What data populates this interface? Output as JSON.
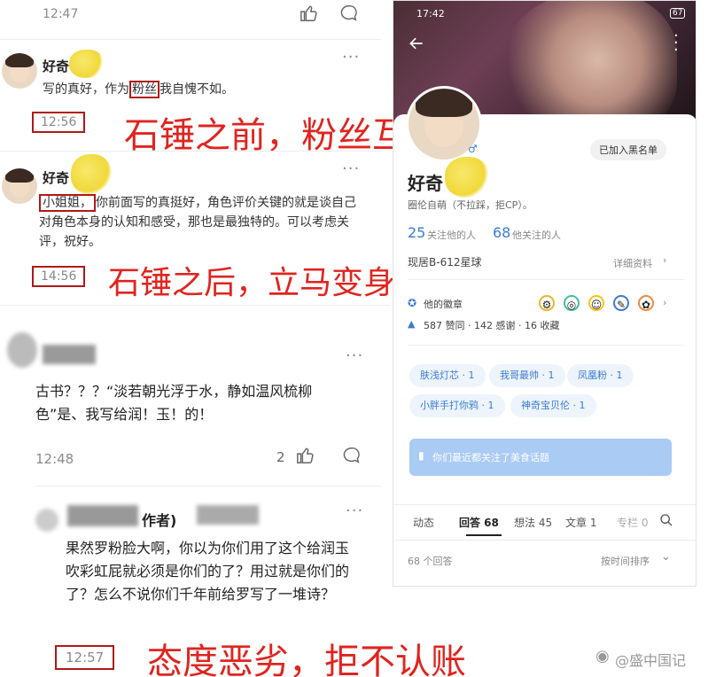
{
  "top_strip": {
    "time": "12:47",
    "like_icon": "thumb-up-icon",
    "comment_icon": "comment-icon"
  },
  "comment1": {
    "username": "好奇",
    "text_prefix": "写的真好，作为",
    "text_highlight": "粉丝",
    "text_suffix": "我自愧不如。",
    "time": "12:56",
    "more": "···"
  },
  "comment2": {
    "username": "好奇",
    "text_highlight": "小姐姐，",
    "text_rest": "你前面写的真挺好，角色评价关键的就是谈自己对角色本身的认知和感受，那也是最独特的。可以考虑关评，祝好。",
    "time": "14:56",
    "more": "···"
  },
  "annotations": {
    "a1": "石锤之前，粉丝互吹",
    "a2": "石锤之后，立马变身小姐姐",
    "a3": "态度恶劣，拒不认账"
  },
  "comment3": {
    "text": "古书？？？“淡若朝光浮于水，静如温风梳柳色”是、我写给润！玉！的！",
    "time": "12:48",
    "likes": "2",
    "more": "···"
  },
  "comment4": {
    "author_tag": "作者)",
    "text": "果然罗粉脸大啊，你以为你们用了这个给润玉吹彩虹屁就必须是你们的了？用过就是你们的了？怎么不说你们千年前给罗写了一堆诗？",
    "time": "12:57",
    "more": "···"
  },
  "phone": {
    "status_time": "17:42",
    "battery": "67",
    "back_icon": "back-arrow-icon",
    "more_icon": "more-icon",
    "blacklist_button": "已加入黑名单",
    "username": "好奇",
    "gender_icon": "male-icon",
    "bio": "圈伦自萌（不拉踩，拒CP）。",
    "followers_count": "25",
    "followers_label": "关注他的人",
    "following_count": "68",
    "following_label": "他关注的人",
    "location": "现居B-612星球",
    "details_link": "详细资料",
    "badges_label": "他的徽章",
    "stats": "587 赞同 · 142 感谢 · 16 收藏",
    "tags": [
      "肤浅灯芯 · 1",
      "我哥最帅 · 1",
      "凤凰粉 · 1",
      "小胖手打你鸦 · 1",
      "神奇宝贝伦 · 1"
    ],
    "topic_banner": "你们最近都关注了美食话题",
    "tabs": [
      "动态",
      "回答 68",
      "想法 45",
      "文章 1",
      "专栏 0"
    ],
    "answers_count": "68 个回答",
    "sort_label": "按时间排序"
  },
  "watermark": "@盛中国记",
  "colors": {
    "accent_red": "#e0241f",
    "box_red": "#b01818",
    "zhihu_blue": "#3a7bd5"
  }
}
